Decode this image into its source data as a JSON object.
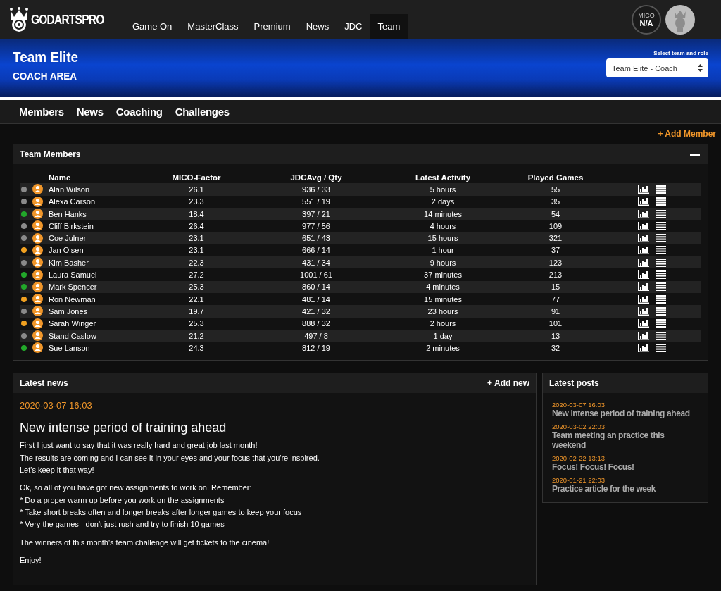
{
  "header": {
    "logo": "GODARTSPRO",
    "nav": [
      {
        "label": "Game On",
        "selected": false
      },
      {
        "label": "MasterClass",
        "selected": false
      },
      {
        "label": "Premium",
        "selected": false
      },
      {
        "label": "News",
        "selected": false
      },
      {
        "label": "JDC",
        "selected": false
      },
      {
        "label": "Team",
        "selected": true
      }
    ],
    "mico_badge": {
      "label": "MICO",
      "value": "N/A"
    }
  },
  "banner": {
    "title": "Team Elite",
    "subtitle": "COACH AREA",
    "select_label": "Select team and role",
    "select_value": "Team Elite - Coach"
  },
  "subnav": [
    "Members",
    "News",
    "Coaching",
    "Challenges"
  ],
  "add_member": "+ Add Member",
  "members": {
    "title": "Team Members",
    "columns": [
      "Name",
      "MICO-Factor",
      "JDCAvg / Qty",
      "Latest Activity",
      "Played Games"
    ],
    "rows": [
      {
        "color": "#8a8a8a",
        "name": "Alan Wilson",
        "mico": "26.1",
        "jdc": "936 / 33",
        "activity": "5 hours",
        "games": "55"
      },
      {
        "color": "#8a8a8a",
        "name": "Alexa Carson",
        "mico": "23.3",
        "jdc": "551 / 19",
        "activity": "2 days",
        "games": "35"
      },
      {
        "color": "#22a82a",
        "name": "Ben Hanks",
        "mico": "18.4",
        "jdc": "397 / 21",
        "activity": "14 minutes",
        "games": "54"
      },
      {
        "color": "#8a8a8a",
        "name": "Cliff Birkstein",
        "mico": "26.4",
        "jdc": "977 / 56",
        "activity": "4 hours",
        "games": "109"
      },
      {
        "color": "#8a8a8a",
        "name": "Coe Julner",
        "mico": "23.1",
        "jdc": "651 / 43",
        "activity": "15 hours",
        "games": "321"
      },
      {
        "color": "#f0a020",
        "name": "Jan Olsen",
        "mico": "23.1",
        "jdc": "666 / 14",
        "activity": "1 hour",
        "games": "37"
      },
      {
        "color": "#8a8a8a",
        "name": "Kim Basher",
        "mico": "22.3",
        "jdc": "431 / 34",
        "activity": "9 hours",
        "games": "123"
      },
      {
        "color": "#22a82a",
        "name": "Laura Samuel",
        "mico": "27.2",
        "jdc": "1001 / 61",
        "activity": "37 minutes",
        "games": "213"
      },
      {
        "color": "#22a82a",
        "name": "Mark Spencer",
        "mico": "25.3",
        "jdc": "860 / 14",
        "activity": "4 minutes",
        "games": "15"
      },
      {
        "color": "#f0a020",
        "name": "Ron Newman",
        "mico": "22.1",
        "jdc": "481 / 14",
        "activity": "15 minutes",
        "games": "77"
      },
      {
        "color": "#8a8a8a",
        "name": "Sam Jones",
        "mico": "19.7",
        "jdc": "421 / 32",
        "activity": "23 hours",
        "games": "91"
      },
      {
        "color": "#f0a020",
        "name": "Sarah Winger",
        "mico": "25.3",
        "jdc": "888 / 32",
        "activity": "2 hours",
        "games": "101"
      },
      {
        "color": "#8a8a8a",
        "name": "Stand Caslow",
        "mico": "21.2",
        "jdc": "497 / 8",
        "activity": "1 day",
        "games": "13"
      },
      {
        "color": "#22a82a",
        "name": "Sue Lanson",
        "mico": "24.3",
        "jdc": "812 / 19",
        "activity": "2 minutes",
        "games": "32"
      }
    ]
  },
  "news": {
    "title": "Latest news",
    "add": "+ Add new",
    "date": "2020-03-07 16:03",
    "headline": "New intense period of training ahead",
    "paragraphs": [
      [
        "First I just want to say that it was really hard and great job last month!",
        "The results are coming and I can see it in your eyes and your focus that you're inspired.",
        "Let's keep it that way!"
      ],
      [
        "Ok, so all of you have got new assignments to work on. Remember:",
        "* Do a proper warm up before you work on the assignments",
        "* Take short breaks often and longer breaks after longer games to keep your focus",
        "* Very the games - don't just rush and try to finish 10 games"
      ],
      [
        "The winners of this month's team challenge will get tickets to the cinema!"
      ],
      [
        "Enjoy!"
      ]
    ]
  },
  "posts": {
    "title": "Latest posts",
    "items": [
      {
        "date": "2020-03-07 16:03",
        "title": "New intense period of training ahead"
      },
      {
        "date": "2020-03-02 22:03",
        "title": "Team meeting an practice this weekend"
      },
      {
        "date": "2020-02-22 13:13",
        "title": "Focus! Focus! Focus!"
      },
      {
        "date": "2020-01-21 22:03",
        "title": "Practice article for the week"
      }
    ]
  }
}
